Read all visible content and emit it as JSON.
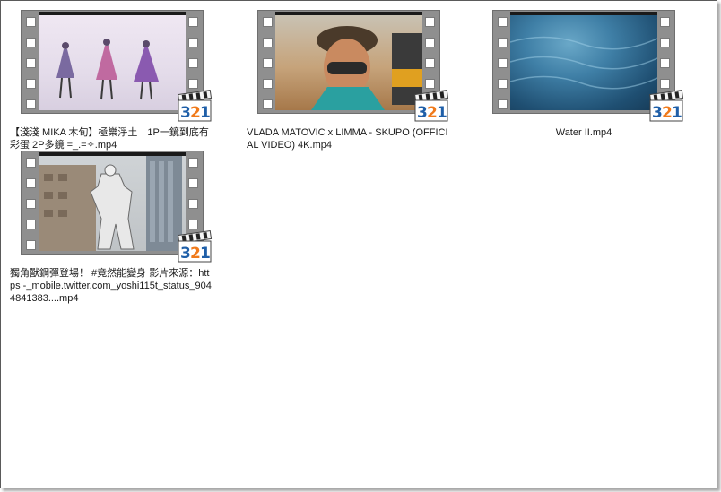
{
  "files": [
    {
      "name": "【淺淺 MIKA 木旬】極樂淨土　1P一鏡到底有彩蛋 2P多鏡 =_.=✧.mp4",
      "type": "video"
    },
    {
      "name": "VLADA MATOVIC x LIMMA - SKUPO (OFFICIAL VIDEO) 4K.mp4",
      "type": "video"
    },
    {
      "name": "Water II.mp4",
      "type": "video"
    },
    {
      "name": "獨角獸鋼彈登場！ #竟然能變身  影片來源：https -_mobile.twitter.com_yoshi115t_status_9044841383....mp4",
      "type": "video"
    }
  ],
  "icons": {
    "overlay": "media-player-classic-321-icon",
    "strip": "film-strip-icon"
  },
  "colors": {
    "strip": "#8f8f8f",
    "badge_orange": "#f07a1b",
    "badge_blue": "#1f5fa8"
  }
}
